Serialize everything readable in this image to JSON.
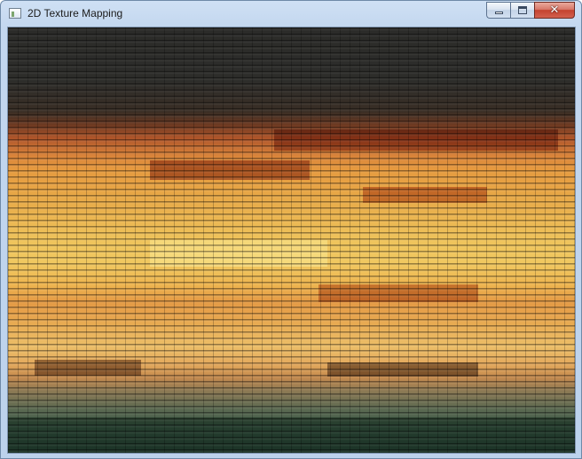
{
  "window": {
    "title": "2D Texture Mapping",
    "app_icon": "window-app-icon",
    "caption_buttons": {
      "minimize_icon": "minimize-icon",
      "maximize_icon": "maximize-icon",
      "close_icon": "close-icon",
      "close_glyph": "✕"
    }
  },
  "viewport": {
    "content": "textured-quad",
    "colors": {
      "top": "#2b2b29",
      "orange": "#d9843a",
      "yellow": "#f0c860",
      "bottom": "#2e4b3d"
    }
  }
}
